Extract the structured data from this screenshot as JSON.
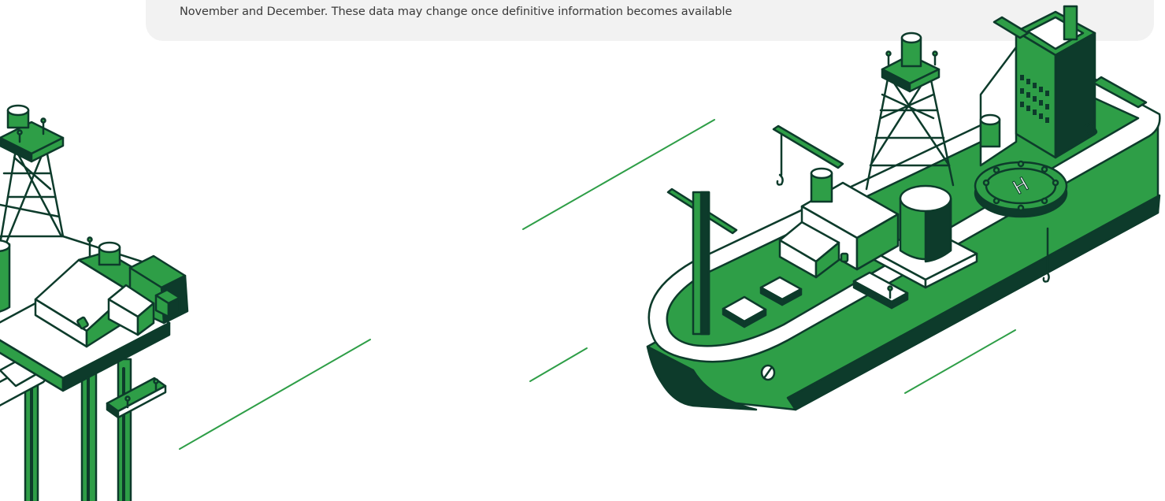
{
  "disclaimer": {
    "text": "November and December. These data may change once definitive information becomes available"
  },
  "illustrations": {
    "left": "offshore-platform-icon",
    "right": "ship-icon",
    "helipad_letter": "H"
  },
  "colors": {
    "green": "#2e9e47",
    "dark": "#0d3b2b",
    "note_background": "#f2f2f2",
    "text": "#3a3a3a"
  }
}
